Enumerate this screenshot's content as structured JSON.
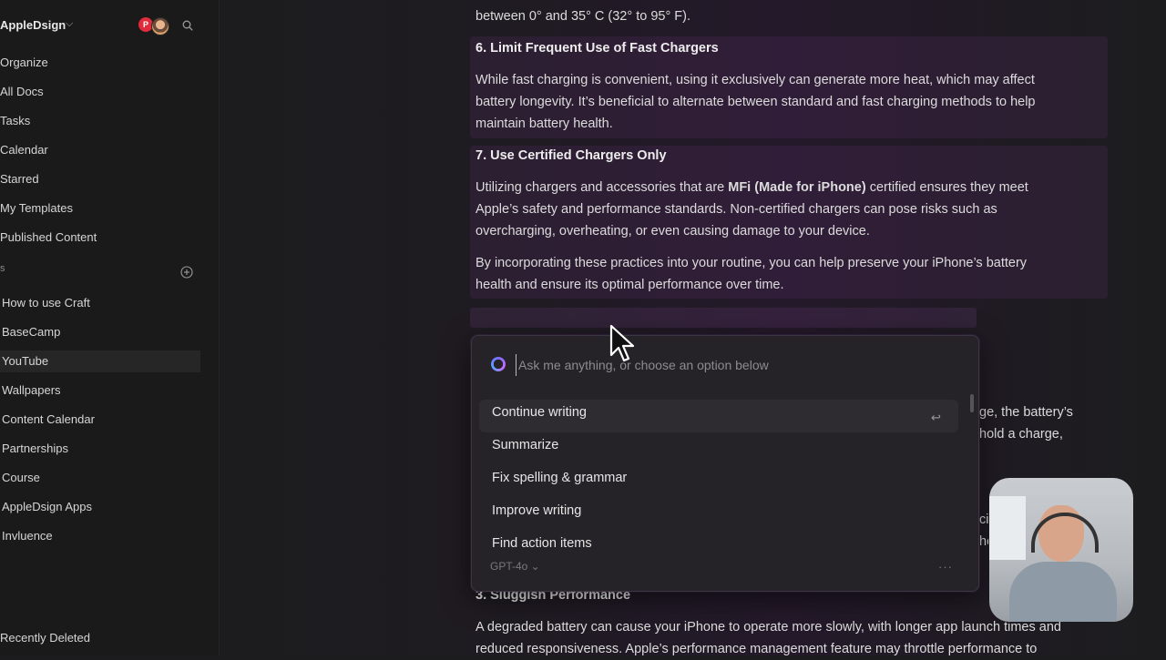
{
  "sidebar": {
    "workspace": "AppleDsign",
    "avatar_letter": "P",
    "nav": [
      "Organize",
      "All Docs",
      "Tasks",
      "Calendar",
      "Starred",
      "My Templates",
      "Published Content"
    ],
    "section_label": "s",
    "folders": [
      "How to use Craft",
      "BaseCamp",
      "YouTube",
      "Wallpapers",
      "Content Calendar",
      "Partnerships",
      "Course",
      "AppleDsign Apps",
      "Invluence"
    ],
    "recently_deleted": "Recently Deleted"
  },
  "doc": {
    "top_line": "between 0° and 35° C (32° to 95° F).",
    "h6": "6. Limit Frequent Use of Fast Chargers",
    "p6a": "While fast charging is convenient, using it exclusively can generate more heat, which may affect",
    "p6b": "battery longevity. It’s beneficial to alternate between standard and fast charging methods to help",
    "p6c": "maintain battery health.",
    "h7": "7. Use Certified Chargers Only",
    "p7a_pre": "Utilizing chargers and accessories that are ",
    "p7a_bold": "MFi (Made for iPhone)",
    "p7a_post": " certified ensures they meet",
    "p7b": "Apple’s safety and performance standards. Non-certified chargers can pose risks such as",
    "p7c": "overcharging, overheating, or even causing damage to your device.",
    "p8a": "By incorporating these practices into your routine, you can help preserve your iPhone’s battery",
    "p8b": "health and ensure its optimal performance over time.",
    "partial1": "ge, the battery’s",
    "partial2": "hold a charge,",
    "partial3": "cie",
    "partial4": "he",
    "h3": "3. Sluggish Performance",
    "p3a": "A degraded battery can cause your iPhone to operate more slowly, with longer app launch times and",
    "p3b": "reduced responsiveness. Apple’s performance management feature may throttle performance to"
  },
  "ai": {
    "placeholder": "Ask me anything, or choose an option below",
    "options": [
      "Continue writing",
      "Summarize",
      "Fix spelling & grammar",
      "Improve writing",
      "Find action items"
    ],
    "model": "GPT-4o ⌄",
    "more": "···",
    "enter_symbol": "↩"
  }
}
